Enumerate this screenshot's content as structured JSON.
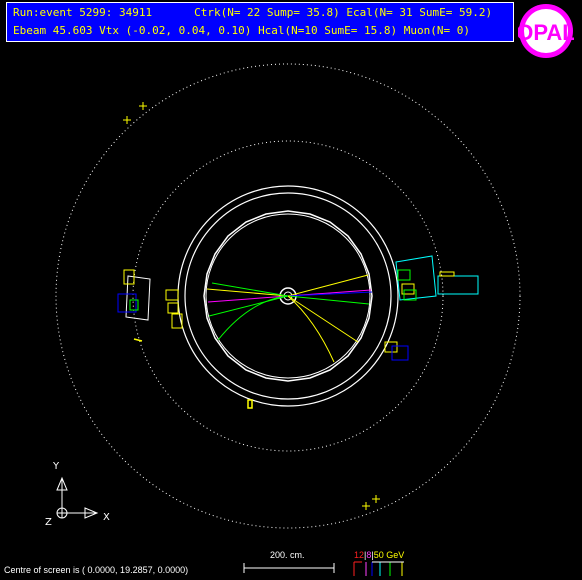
{
  "header": {
    "line1": {
      "run_event": "Run:event 5299: 34911",
      "ctrk": "Ctrk(N= 22 Sump= 35.8)",
      "ecal": "Ecal(N= 31 SumE= 59.2)"
    },
    "line2": {
      "ebeam": "Ebeam 45.603",
      "vtx": "Vtx (-0.02, 0.04, 0.10)",
      "hcal": "Hcal(N=10 SumE= 15.8)",
      "muon": "Muon(N= 0)"
    }
  },
  "logo": {
    "text": "OPAL"
  },
  "axes": {
    "y": "Y",
    "x": "X",
    "z": "Z"
  },
  "footer": {
    "centre_text": "Centre of screen is (   0.0000,  19.2857,    0.0000)"
  },
  "scale": {
    "label": "200. cm."
  },
  "legend": {
    "items": [
      {
        "text": "12",
        "color": "#ff2020"
      },
      {
        "text": "|",
        "color": "#ffffff"
      },
      {
        "text": "8",
        "color": "#ff40ff"
      },
      {
        "text": "|",
        "color": "#ffffff"
      },
      {
        "text": "50 GeV",
        "color": "#ffff00"
      }
    ]
  },
  "colors": {
    "background": "#000000",
    "header_bg": "#0000ff",
    "header_text": "#ffff00",
    "detector": "#ffffff",
    "track_green": "#00ff00",
    "track_yellow": "#ffff00",
    "track_magenta": "#ff00ff",
    "ecal_yellow": "#ffff00",
    "hcal_blue": "#0000ff",
    "muon_cyan": "#00ffff"
  }
}
